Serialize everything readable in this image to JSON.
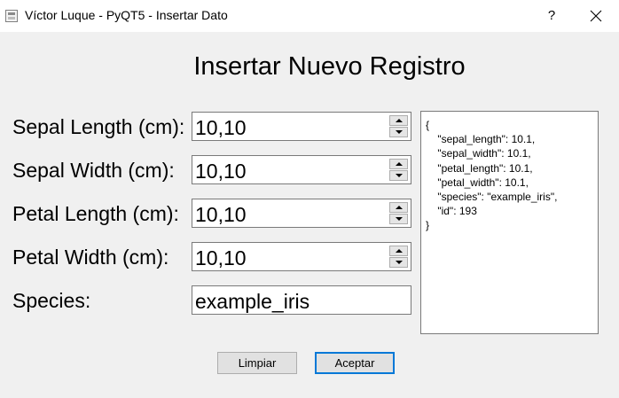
{
  "window": {
    "title": "Víctor Luque - PyQT5 - Insertar Dato",
    "help_label": "?"
  },
  "form": {
    "heading": "Insertar Nuevo Registro",
    "sepal_length": {
      "label": "Sepal Length (cm):",
      "value": "10,10"
    },
    "sepal_width": {
      "label": "Sepal Width (cm):",
      "value": "10,10"
    },
    "petal_length": {
      "label": "Petal Length (cm):",
      "value": "10,10"
    },
    "petal_width": {
      "label": "Petal Width (cm):",
      "value": "10,10"
    },
    "species": {
      "label": "Species:",
      "value": "example_iris"
    }
  },
  "preview": {
    "json_text": "{\n    \"sepal_length\": 10.1,\n    \"sepal_width\": 10.1,\n    \"petal_length\": 10.1,\n    \"petal_width\": 10.1,\n    \"species\": \"example_iris\",\n    \"id\": 193\n}"
  },
  "buttons": {
    "clear_label": "Limpiar",
    "accept_label": "Aceptar"
  }
}
